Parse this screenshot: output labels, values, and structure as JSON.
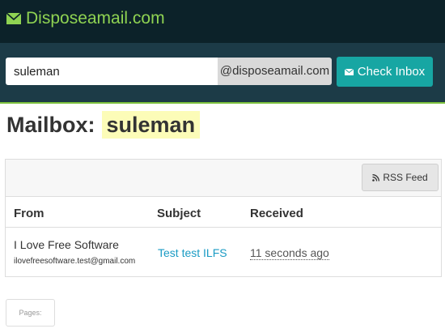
{
  "header": {
    "brand": "Disposeamail.com",
    "brand_icon": "envelope-icon",
    "brand_color": "#8fd352",
    "bg_color": "#0c2229"
  },
  "search": {
    "username_value": "suleman",
    "domain_suffix": "@disposeamail.com",
    "check_button_label": "Check Inbox",
    "button_icon": "envelope-icon",
    "accent_color": "#17a6a3"
  },
  "mailbox": {
    "title_prefix": "Mailbox:",
    "name": "suleman"
  },
  "inbox": {
    "rss_label": "RSS Feed",
    "rss_icon": "rss-icon",
    "columns": [
      "From",
      "Subject",
      "Received"
    ],
    "messages": [
      {
        "from_name": "I Love Free Software",
        "from_email": "ilovefreesoftware.test@gmail.com",
        "subject": "Test test ILFS",
        "received": "11 seconds ago"
      }
    ]
  },
  "pagination": {
    "label": "Pages:"
  }
}
